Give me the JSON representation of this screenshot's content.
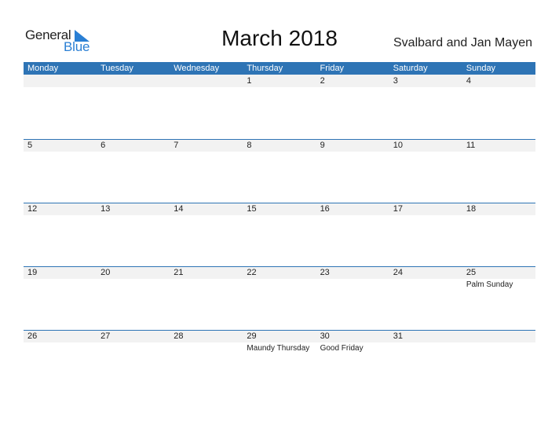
{
  "logo": {
    "general": "General",
    "blue": "Blue",
    "brand_color": "#2a7fd4"
  },
  "title": "March 2018",
  "country": "Svalbard and Jan Mayen",
  "header_color": "#2e74b5",
  "weekdays": [
    "Monday",
    "Tuesday",
    "Wednesday",
    "Thursday",
    "Friday",
    "Saturday",
    "Sunday"
  ],
  "weeks": [
    [
      {
        "day": ""
      },
      {
        "day": ""
      },
      {
        "day": ""
      },
      {
        "day": "1"
      },
      {
        "day": "2"
      },
      {
        "day": "3"
      },
      {
        "day": "4"
      }
    ],
    [
      {
        "day": "5"
      },
      {
        "day": "6"
      },
      {
        "day": "7"
      },
      {
        "day": "8"
      },
      {
        "day": "9"
      },
      {
        "day": "10"
      },
      {
        "day": "11"
      }
    ],
    [
      {
        "day": "12"
      },
      {
        "day": "13"
      },
      {
        "day": "14"
      },
      {
        "day": "15"
      },
      {
        "day": "16"
      },
      {
        "day": "17"
      },
      {
        "day": "18"
      }
    ],
    [
      {
        "day": "19"
      },
      {
        "day": "20"
      },
      {
        "day": "21"
      },
      {
        "day": "22"
      },
      {
        "day": "23"
      },
      {
        "day": "24"
      },
      {
        "day": "25",
        "holiday": "Palm Sunday"
      }
    ],
    [
      {
        "day": "26"
      },
      {
        "day": "27"
      },
      {
        "day": "28"
      },
      {
        "day": "29",
        "holiday": "Maundy Thursday"
      },
      {
        "day": "30",
        "holiday": "Good Friday"
      },
      {
        "day": "31"
      },
      {
        "day": ""
      }
    ]
  ]
}
